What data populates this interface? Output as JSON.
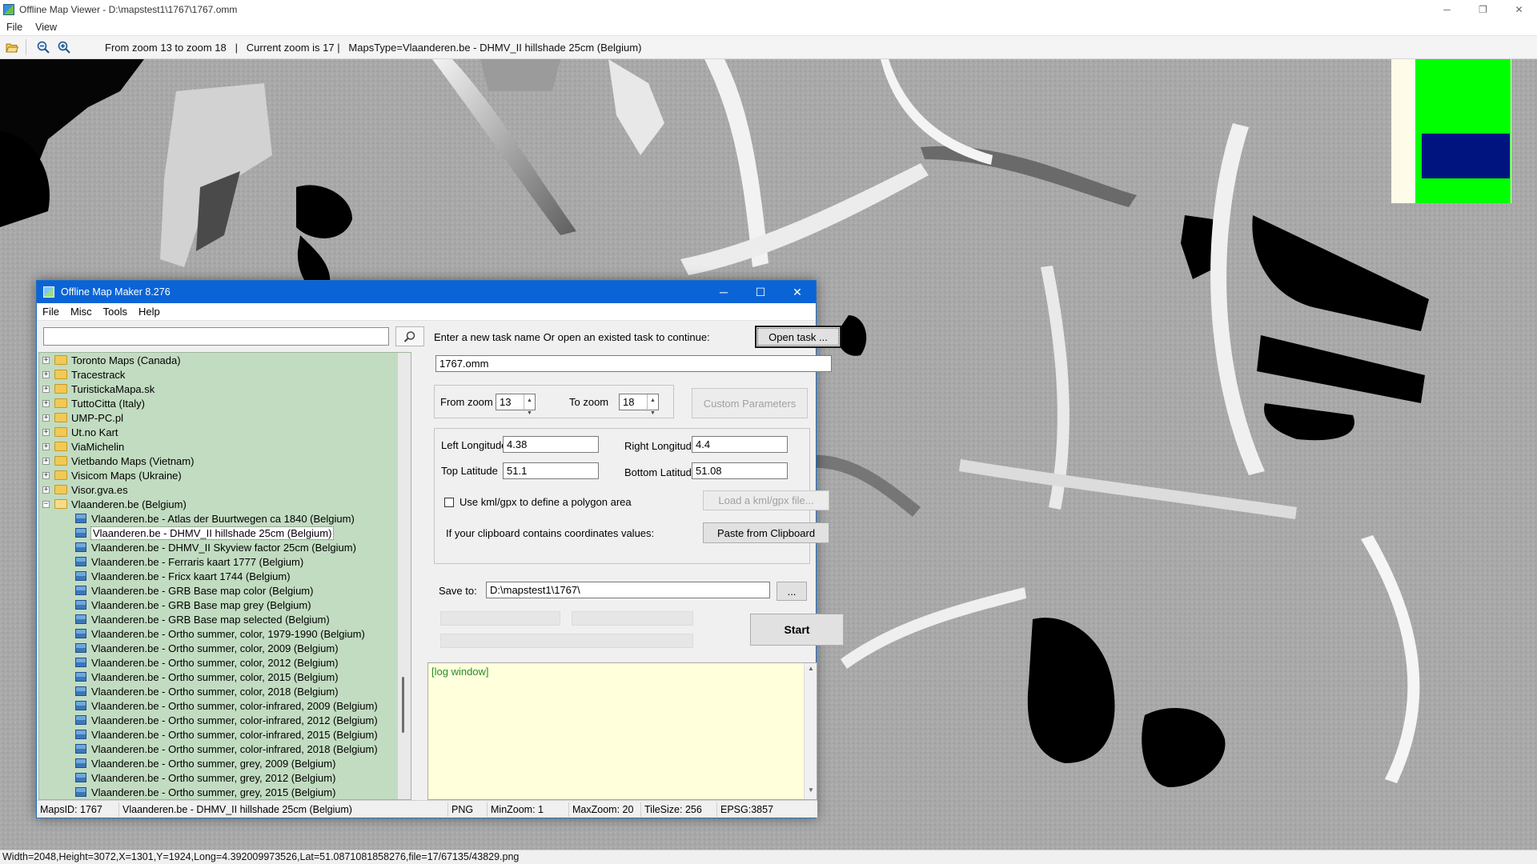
{
  "window": {
    "title": "Offline Map Viewer - D:\\mapstest1\\1767\\1767.omm",
    "controls": [
      "─",
      "❐",
      "✕"
    ]
  },
  "menubar": [
    "File",
    "View"
  ],
  "toolbar": {
    "info": "From zoom 13 to zoom 18   |   Current zoom is 17 |   MapsType=Vlaanderen.be - DHMV_II hillshade 25cm (Belgium)",
    "icons": [
      "open-folder-icon",
      "zoom-out-icon",
      "zoom-in-icon"
    ]
  },
  "minimap": {
    "bg": "#fffbe9",
    "green": "#00ff00",
    "blue": "#001480"
  },
  "status": "Width=2048,Height=3072,X=1301,Y=1924,Long=4.392009973526,Lat=51.0871081858276,file=17/67135/43829.png",
  "dialog": {
    "title": "Offline Map Maker 8.276",
    "menu": [
      "File",
      "Misc",
      "Tools",
      "Help"
    ],
    "search": {
      "value": "",
      "placeholder": ""
    },
    "tree": {
      "folders": [
        "Toronto Maps (Canada)",
        "Tracestrack",
        "TuristickaMapa.sk",
        "TuttoCitta (Italy)",
        "UMP-PC.pl",
        "Ut.no Kart",
        "ViaMichelin",
        "Vietbando Maps (Vietnam)",
        "Visicom Maps (Ukraine)",
        "Visor.gva.es"
      ],
      "open_folder": "Vlaanderen.be (Belgium)",
      "children": [
        "Vlaanderen.be - Atlas der Buurtwegen ca 1840 (Belgium)",
        "Vlaanderen.be - DHMV_II hillshade 25cm (Belgium)",
        "Vlaanderen.be - DHMV_II Skyview factor 25cm (Belgium)",
        "Vlaanderen.be - Ferraris kaart 1777 (Belgium)",
        "Vlaanderen.be - Fricx kaart 1744 (Belgium)",
        "Vlaanderen.be - GRB Base map color (Belgium)",
        "Vlaanderen.be - GRB Base map grey (Belgium)",
        "Vlaanderen.be - GRB Base map selected (Belgium)",
        "Vlaanderen.be - Ortho summer, color, 1979-1990 (Belgium)",
        "Vlaanderen.be - Ortho summer, color, 2009 (Belgium)",
        "Vlaanderen.be - Ortho summer, color, 2012 (Belgium)",
        "Vlaanderen.be - Ortho summer, color, 2015 (Belgium)",
        "Vlaanderen.be - Ortho summer, color, 2018 (Belgium)",
        "Vlaanderen.be - Ortho summer, color-infrared, 2009 (Belgium)",
        "Vlaanderen.be - Ortho summer, color-infrared, 2012 (Belgium)",
        "Vlaanderen.be - Ortho summer, color-infrared, 2015 (Belgium)",
        "Vlaanderen.be - Ortho summer, color-infrared, 2018 (Belgium)",
        "Vlaanderen.be - Ortho summer, grey, 2009 (Belgium)",
        "Vlaanderen.be - Ortho summer, grey, 2012 (Belgium)",
        "Vlaanderen.be - Ortho summer, grey, 2015 (Belgium)"
      ],
      "selected": "Vlaanderen.be - DHMV_II hillshade 25cm (Belgium)"
    },
    "task": {
      "prompt": "Enter a new task name Or open an existed task to continue:",
      "open_button": "Open task ...",
      "name_value": "1767.omm"
    },
    "zoom": {
      "from_label": "From zoom",
      "from_value": "13",
      "to_label": "To zoom",
      "to_value": "18",
      "custom_button": "Custom Parameters"
    },
    "coords": {
      "left_lon_label": "Left Longitude",
      "left_lon": "4.38",
      "right_lon_label": "Right Longitude",
      "right_lon": "4.4",
      "top_lat_label": "Top Latitude",
      "top_lat": "51.1",
      "bottom_lat_label": "Bottom Latitude",
      "bottom_lat": "51.08",
      "kml_label": "Use kml/gpx to define a polygon area",
      "kml_checked": false,
      "kml_button": "Load a kml/gpx file...",
      "clipboard_label": "If your clipboard contains coordinates values:",
      "clipboard_button": "Paste from Clipboard"
    },
    "save": {
      "label": "Save to:",
      "path": "D:\\mapstest1\\1767\\",
      "browse_button": "...",
      "start_button": "Start"
    },
    "log": {
      "text": "[log window]"
    },
    "statusbar": {
      "maps_id": "MapsID: 1767",
      "map_name": "Vlaanderen.be - DHMV_II hillshade 25cm (Belgium)",
      "format": "PNG",
      "min_zoom": "MinZoom: 1",
      "max_zoom": "MaxZoom: 20",
      "tile_size": "TileSize: 256",
      "epsg": "EPSG:3857"
    }
  }
}
